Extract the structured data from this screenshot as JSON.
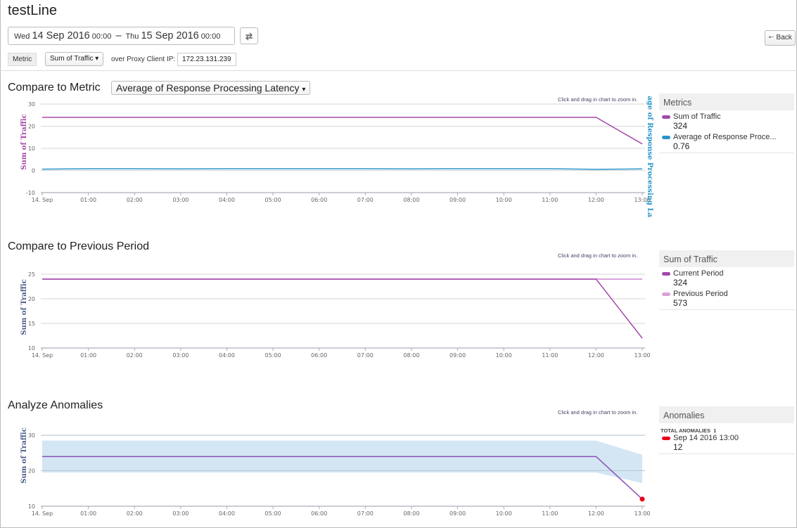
{
  "header": {
    "title": "testLine",
    "date_from_prefix": "Wed",
    "date_from_main": "14 Sep 2016",
    "date_from_time": "00:00",
    "separator": "–",
    "date_to_prefix": "Thu",
    "date_to_main": "15 Sep 2016",
    "date_to_time": "00:00",
    "swap_icon": "swap-icon",
    "back_label": "Back",
    "back_icon": "back-arrow-icon"
  },
  "filters": {
    "metric_label": "Metric",
    "metric_value": "Sum of Traffic",
    "over_label": "over Proxy Client IP:",
    "ip_value": "172.23.131.239"
  },
  "sections": {
    "compare_metric": {
      "title": "Compare to Metric",
      "select_value": "Average of Response Processing Latency",
      "zoom_hint": "Click and drag in chart to zoom in.",
      "legend": {
        "title": "Metrics",
        "items": [
          {
            "label": "Sum of Traffic",
            "value": "324",
            "color": "#a34aa8"
          },
          {
            "label": "Average of Response Proce...",
            "value": "0.76",
            "color": "#2a95c9"
          }
        ]
      }
    },
    "compare_previous": {
      "title": "Compare to Previous Period",
      "zoom_hint": "Click and drag in chart to zoom in.",
      "legend": {
        "title": "Sum of Traffic",
        "items": [
          {
            "label": "Current Period",
            "value": "324",
            "color": "#a34aa8"
          },
          {
            "label": "Previous Period",
            "value": "573",
            "color": "#d9a2d9"
          }
        ]
      }
    },
    "anomalies": {
      "title": "Analyze Anomalies",
      "zoom_hint": "Click and drag in chart to zoom in.",
      "legend": {
        "title": "Anomalies",
        "total_label": "TOTAL ANOMALIES",
        "total_value": "1",
        "items": [
          {
            "label": "Sep 14 2016 13:00",
            "value": "12",
            "color": "#e8001c"
          }
        ]
      }
    }
  },
  "chart_data": [
    {
      "type": "line",
      "title": "Compare to Metric",
      "x": [
        "14. Sep",
        "01:00",
        "02:00",
        "03:00",
        "04:00",
        "05:00",
        "06:00",
        "07:00",
        "08:00",
        "09:00",
        "10:00",
        "11:00",
        "12:00",
        "13:00"
      ],
      "ylabel": "Sum of Traffic",
      "y2label": "Average of Response Processing Latency",
      "yticks": [
        -10,
        0,
        10,
        20,
        30
      ],
      "ylim": [
        -10,
        30
      ],
      "grid": true,
      "series": [
        {
          "name": "Sum of Traffic",
          "color": "#a34aa8",
          "values": [
            24,
            24,
            24,
            24,
            24,
            24,
            24,
            24,
            24,
            24,
            24,
            24,
            24,
            12
          ]
        },
        {
          "name": "Average of Response Processing Latency",
          "color": "#2a95c9",
          "values": [
            0.6,
            0.8,
            0.8,
            0.7,
            0.8,
            0.8,
            0.8,
            0.8,
            0.7,
            0.8,
            0.8,
            0.8,
            0.5,
            0.7
          ]
        }
      ]
    },
    {
      "type": "line",
      "title": "Compare to Previous Period",
      "x": [
        "14. Sep",
        "01:00",
        "02:00",
        "03:00",
        "04:00",
        "05:00",
        "06:00",
        "07:00",
        "08:00",
        "09:00",
        "10:00",
        "11:00",
        "12:00",
        "13:00"
      ],
      "ylabel": "Sum of Traffic",
      "yticks": [
        10,
        15,
        20,
        25
      ],
      "ylim": [
        10,
        26
      ],
      "grid": true,
      "series": [
        {
          "name": "Current Period",
          "color": "#a34aa8",
          "values": [
            24,
            24,
            24,
            24,
            24,
            24,
            24,
            24,
            24,
            24,
            24,
            24,
            24,
            12
          ]
        },
        {
          "name": "Previous Period",
          "color": "#d9a2d9",
          "values": [
            24,
            24,
            24,
            24,
            24,
            24,
            24,
            24,
            24,
            24,
            24,
            24,
            24,
            24
          ]
        }
      ]
    },
    {
      "type": "area",
      "title": "Analyze Anomalies",
      "x": [
        "14. Sep",
        "01:00",
        "02:00",
        "03:00",
        "04:00",
        "05:00",
        "06:00",
        "07:00",
        "08:00",
        "09:00",
        "10:00",
        "11:00",
        "12:00",
        "13:00"
      ],
      "ylabel": "Sum of Traffic",
      "yticks": [
        10,
        20,
        30
      ],
      "ylim": [
        10,
        32
      ],
      "grid": true,
      "band": {
        "upper": [
          28.5,
          28.5,
          28.5,
          28.5,
          28.5,
          28.5,
          28.5,
          28.5,
          28.5,
          28.5,
          28.5,
          28.5,
          28.5,
          24.5
        ],
        "lower": [
          19.5,
          19.5,
          19.5,
          19.5,
          19.5,
          19.5,
          19.5,
          19.5,
          19.5,
          19.5,
          19.5,
          19.5,
          19.5,
          16.5
        ]
      },
      "series": [
        {
          "name": "Sum of Traffic",
          "color": "#8a4fb8",
          "values": [
            24,
            24,
            24,
            24,
            24,
            24,
            24,
            24,
            24,
            24,
            24,
            24,
            24,
            12
          ]
        }
      ],
      "anomalies": [
        {
          "x": "13:00",
          "y": 12,
          "color": "#e8001c"
        }
      ]
    }
  ]
}
